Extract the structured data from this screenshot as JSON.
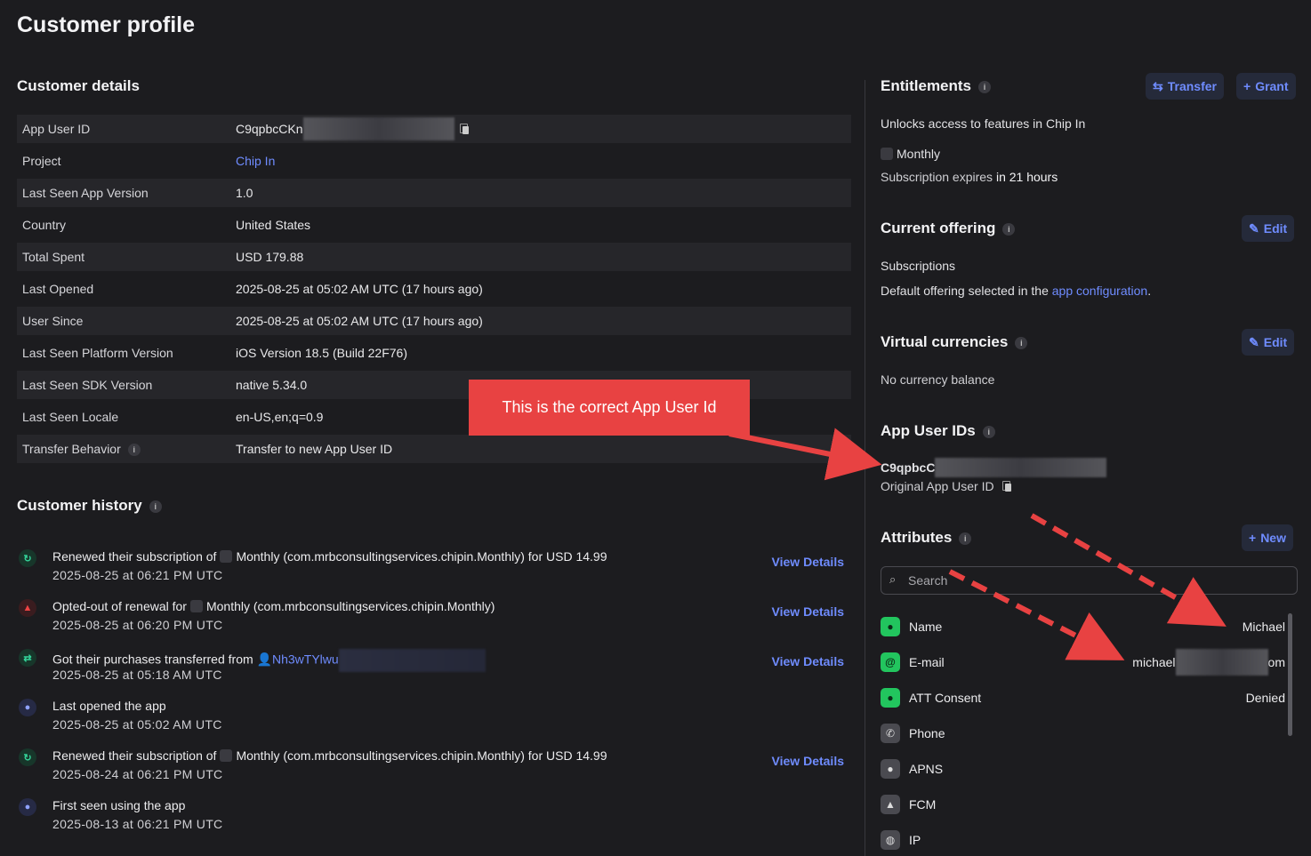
{
  "page": {
    "title": "Customer profile"
  },
  "details": {
    "heading": "Customer details",
    "rows": [
      {
        "label": "App User ID",
        "value": "C9qpbcCKn"
      },
      {
        "label": "Project",
        "value": "Chip In"
      },
      {
        "label": "Last Seen App Version",
        "value": "1.0"
      },
      {
        "label": "Country",
        "value": "United States"
      },
      {
        "label": "Total Spent",
        "value": "USD 179.88"
      },
      {
        "label": "Last Opened",
        "value": "2025-08-25 at 05:02 AM UTC (17 hours ago)"
      },
      {
        "label": "User Since",
        "value": "2025-08-25 at 05:02 AM UTC (17 hours ago)"
      },
      {
        "label": "Last Seen Platform Version",
        "value": "iOS Version 18.5 (Build 22F76)"
      },
      {
        "label": "Last Seen SDK Version",
        "value": "native 5.34.0"
      },
      {
        "label": "Last Seen Locale",
        "value": "en-US,en;q=0.9"
      },
      {
        "label": "Transfer Behavior",
        "value": "Transfer to new App User ID"
      }
    ]
  },
  "history": {
    "heading": "Customer history",
    "view_details": "View Details",
    "items": [
      {
        "icon": "renew-icon",
        "prefix": "Renewed their subscription of",
        "product": "Monthly (com.mrbconsultingservices.chipin.Monthly) for USD 14.99",
        "time": "2025-08-25 at 06:21 PM UTC"
      },
      {
        "icon": "warning-icon",
        "prefix": "Opted-out of renewal for",
        "product": "Monthly (com.mrbconsultingservices.chipin.Monthly)",
        "time": "2025-08-25 at 06:20 PM UTC"
      },
      {
        "icon": "transfer-icon",
        "prefix": "Got their purchases transferred from",
        "product": "Nh3wTYlwu",
        "time": "2025-08-25 at 05:18 AM UTC"
      },
      {
        "icon": "user-icon",
        "prefix": "Last opened the app",
        "product": "",
        "time": "2025-08-25 at 05:02 AM UTC"
      },
      {
        "icon": "renew-icon",
        "prefix": "Renewed their subscription of",
        "product": "Monthly (com.mrbconsultingservices.chipin.Monthly) for USD 14.99",
        "time": "2025-08-24 at 06:21 PM UTC"
      },
      {
        "icon": "user-icon",
        "prefix": "First seen using the app",
        "product": "",
        "time": "2025-08-13 at 06:21 PM UTC"
      }
    ]
  },
  "entitlements": {
    "heading": "Entitlements",
    "transfer_label": "Transfer",
    "grant_label": "Grant",
    "unlocks_text": "Unlocks access to features in Chip In",
    "product": "Monthly",
    "expires_prefix": "Subscription expires",
    "expires_value": "in 21 hours"
  },
  "offering": {
    "heading": "Current offering",
    "edit_label": "Edit",
    "name": "Subscriptions",
    "desc_prefix": "Default offering selected in the",
    "desc_link": "app configuration",
    "desc_suffix": "."
  },
  "currencies": {
    "heading": "Virtual currencies",
    "edit_label": "Edit",
    "empty_text": "No currency balance"
  },
  "app_user_ids": {
    "heading": "App User IDs",
    "id": "C9qpbcC",
    "caption": "Original App User ID"
  },
  "attributes": {
    "heading": "Attributes",
    "new_label": "New",
    "search_placeholder": "Search",
    "rows": [
      {
        "name": "Name",
        "value": "Michael",
        "icon_color": "#22c55e"
      },
      {
        "name": "E-mail",
        "value_start": "michael",
        "value_end": "om",
        "icon_color": "#22c55e"
      },
      {
        "name": "ATT Consent",
        "value": "Denied",
        "icon_color": "#22c55e"
      },
      {
        "name": "Phone",
        "value": "",
        "icon_color": "#4a4a50"
      },
      {
        "name": "APNS",
        "value": "",
        "icon_color": "#4a4a50"
      },
      {
        "name": "FCM",
        "value": "",
        "icon_color": "#4a4a50"
      },
      {
        "name": "IP",
        "value": "",
        "icon_color": "#4a4a50"
      }
    ]
  },
  "annotation": {
    "callout_text": "This is the correct App User Id",
    "color": "#e84242"
  }
}
